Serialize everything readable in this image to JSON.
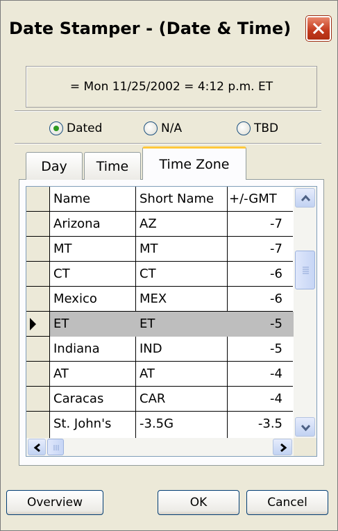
{
  "window": {
    "title": "Date Stamper - (Date & Time)"
  },
  "display": {
    "datetime_text": "= Mon 11/25/2002 = 4:12 p.m. ET"
  },
  "radios": [
    {
      "label": "Dated",
      "selected": true
    },
    {
      "label": "N/A",
      "selected": false
    },
    {
      "label": "TBD",
      "selected": false
    }
  ],
  "tabs": [
    {
      "label": "Day",
      "active": false
    },
    {
      "label": "Time",
      "active": false
    },
    {
      "label": "Time Zone",
      "active": true
    }
  ],
  "grid": {
    "columns": [
      "Name",
      "Short Name",
      "+/-GMT"
    ],
    "rows": [
      {
        "name": "Arizona",
        "short": "AZ",
        "gmt": "-7"
      },
      {
        "name": "MT",
        "short": "MT",
        "gmt": "-7"
      },
      {
        "name": "CT",
        "short": "CT",
        "gmt": "-6"
      },
      {
        "name": "Mexico",
        "short": "MEX",
        "gmt": "-6"
      },
      {
        "name": "ET",
        "short": "ET",
        "gmt": "-5",
        "selected": true
      },
      {
        "name": "Indiana",
        "short": "IND",
        "gmt": "-5"
      },
      {
        "name": "AT",
        "short": "AT",
        "gmt": "-4"
      },
      {
        "name": "Caracas",
        "short": "CAR",
        "gmt": "-4"
      },
      {
        "name": "St. John's",
        "short": "-3.5G",
        "gmt": "-3.5"
      }
    ]
  },
  "buttons": {
    "overview": "Overview",
    "ok": "OK",
    "cancel": "Cancel"
  },
  "colors": {
    "close_button": "#c2391d",
    "selected_row": "#bebebe",
    "active_tab_accent": "#ffc83c"
  }
}
